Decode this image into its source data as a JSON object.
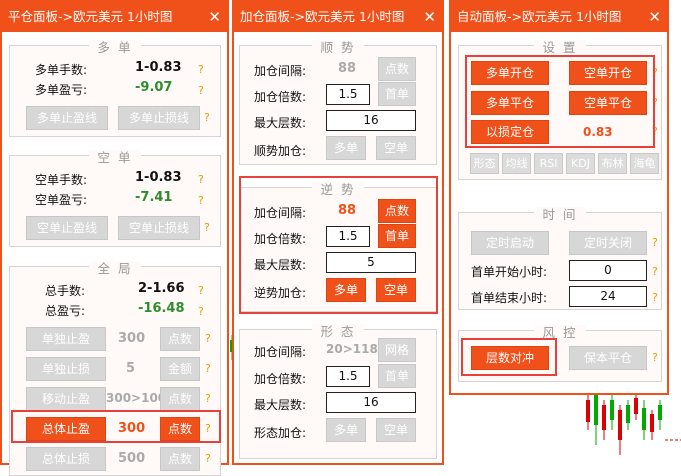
{
  "panel1": {
    "title": "平仓面板->欧元美元 1小时图",
    "close": "✕",
    "long": {
      "title": "多单",
      "lots_label": "多单手数:",
      "lots_value": "1-0.83",
      "pl_label": "多单盈亏:",
      "pl_value": "-9.07",
      "tp_button": "多单止盈线",
      "sl_button": "多单止损线"
    },
    "short": {
      "title": "空单",
      "lots_label": "空单手数:",
      "lots_value": "1-0.83",
      "pl_label": "空单盈亏:",
      "pl_value": "-7.41",
      "tp_button": "空单止盈线",
      "sl_button": "空单止损线"
    },
    "global": {
      "title": "全局",
      "lots_label": "总手数:",
      "lots_value": "2-1.66",
      "pl_label": "总盈亏:",
      "pl_value": "-16.48",
      "rows": [
        {
          "button": "单独止盈",
          "value": "300",
          "unit": "点数"
        },
        {
          "button": "单独止损",
          "value": "5",
          "unit": "金额"
        },
        {
          "button": "移动止盈",
          "value": "300>100",
          "unit": "点数"
        },
        {
          "button": "总体止盈",
          "value": "300",
          "unit": "点数"
        },
        {
          "button": "总体止损",
          "value": "500",
          "unit": "点数"
        }
      ]
    }
  },
  "panel2": {
    "title": "加仓面板->欧元美元 1小时图",
    "close": "✕",
    "trend": {
      "title": "顺势",
      "interval_label": "加仓间隔:",
      "interval_value": "88",
      "interval_unit": "点数",
      "mult_label": "加仓倍数:",
      "mult_value": "1.5",
      "mult_mode": "首单",
      "max_label": "最大层数:",
      "max_value": "16",
      "add_label": "顺势加仓:",
      "buy": "多单",
      "sell": "空单"
    },
    "counter": {
      "title": "逆势",
      "interval_label": "加仓间隔:",
      "interval_value": "88",
      "interval_unit": "点数",
      "mult_label": "加仓倍数:",
      "mult_value": "1.5",
      "mult_mode": "首单",
      "max_label": "最大层数:",
      "max_value": "5",
      "add_label": "逆势加仓:",
      "buy": "多单",
      "sell": "空单"
    },
    "shape": {
      "title": "形态",
      "interval_label": "加仓间隔:",
      "interval_value": "20>118",
      "interval_unit": "网格",
      "mult_label": "加仓倍数:",
      "mult_value": "1.5",
      "mult_mode": "首单",
      "max_label": "最大层数:",
      "max_value": "16",
      "add_label": "形态加仓:",
      "buy": "多单",
      "sell": "空单"
    }
  },
  "panel3": {
    "title": "自动面板->欧元美元 1小时图",
    "close": "✕",
    "settings": {
      "title": "设置",
      "open_long": "多单开仓",
      "open_short": "空单开仓",
      "close_long": "多单平仓",
      "close_short": "空单平仓",
      "loss_open": "以损定仓",
      "loss_value": "0.83",
      "indicators": [
        "形态",
        "均线",
        "RSI",
        "KDJ",
        "布林",
        "海龟"
      ]
    },
    "time": {
      "title": "时间",
      "timer_start": "定时启动",
      "timer_stop": "定时关闭",
      "start_label": "首单开始小时:",
      "start_value": "0",
      "end_label": "首单结束小时:",
      "end_value": "24"
    },
    "risk": {
      "title": "风控",
      "hedge": "层数对冲",
      "breakeven": "保本平仓"
    }
  },
  "help_mark": "?",
  "colors": {
    "accent": "#f0501a",
    "highlight": "#e8403a",
    "profit_green": "#2d8c2d",
    "hint_yellow": "#e0a000"
  }
}
